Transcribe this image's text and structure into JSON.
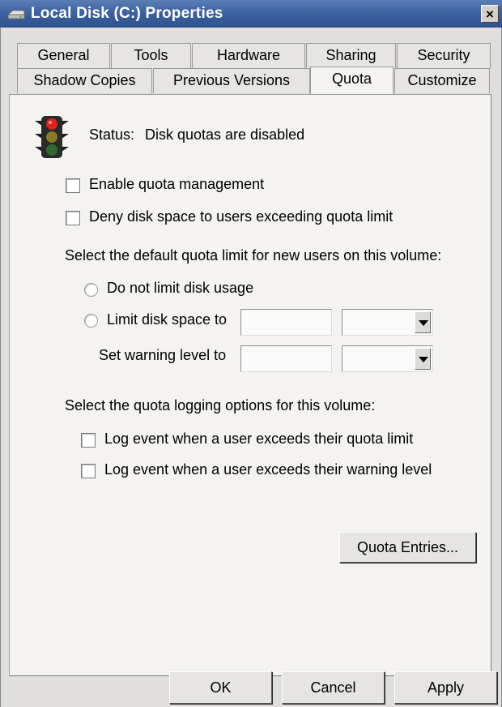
{
  "window": {
    "title": "Local Disk (C:) Properties",
    "close_label": "×",
    "title_icon": "drive-icon"
  },
  "tabs": {
    "row1": [
      "General",
      "Tools",
      "Hardware",
      "Sharing",
      "Security"
    ],
    "row2": [
      "Shadow Copies",
      "Previous Versions",
      "Quota",
      "Customize"
    ],
    "active": "Quota"
  },
  "status": {
    "icon": "traffic-light-icon",
    "label": "Status:",
    "text": "Disk quotas are disabled"
  },
  "options": {
    "enable_quota": {
      "label": "Enable quota management",
      "checked": false
    },
    "deny_space": {
      "label": "Deny disk space to users exceeding quota limit",
      "checked": false
    }
  },
  "default_limit": {
    "heading": "Select the default quota limit for new users on this volume:",
    "no_limit_label": "Do not limit disk usage",
    "limit_label": "Limit disk space to",
    "warning_label": "Set warning level to",
    "limit_value": "",
    "limit_unit": "",
    "warning_value": "",
    "warning_unit": ""
  },
  "logging": {
    "heading": "Select the quota logging options for this volume:",
    "log_limit_label": "Log event when a user exceeds their quota limit",
    "log_warning_label": "Log event when a user exceeds their warning level"
  },
  "buttons": {
    "quota_entries": "Quota Entries...",
    "ok": "OK",
    "cancel": "Cancel",
    "apply": "Apply"
  },
  "colors": {
    "titlebar": "#3d62a0",
    "dialog": "#e0dfdb",
    "panel": "#f4f3ef"
  }
}
